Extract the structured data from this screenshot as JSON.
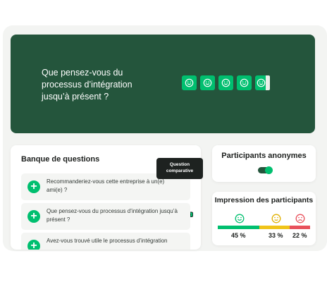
{
  "hero": {
    "question": "Que pensez-vous du processus d’intégration jusqu’à présent ?",
    "rating_icons": [
      "smiley-icon",
      "smiley-icon",
      "smiley-icon",
      "smiley-icon",
      "smiley-icon"
    ]
  },
  "question_bank": {
    "title": "Banque de questions",
    "items": [
      {
        "text": "Recommanderiez-vous cette entreprise à un(e) ami(e) ?",
        "icon": "plus-icon"
      },
      {
        "text": "Que pensez-vous du processus d’intégration jusqu’à présent ?",
        "icon": "plus-icon"
      },
      {
        "text": "Avez-vous trouvé utile le processus d’intégration",
        "icon": "plus-icon"
      }
    ]
  },
  "tooltip": {
    "text": "Question comparative"
  },
  "anonymous": {
    "title": "Participants anonymes",
    "toggle_on": true
  },
  "impression": {
    "title": "Impression des participants",
    "segments": [
      {
        "icon": "happy-face-icon",
        "percent": 45,
        "label": "45 %",
        "color": "#00bf6f"
      },
      {
        "icon": "neutral-face-icon",
        "percent": 33,
        "label": "33 %",
        "color": "#f0c419"
      },
      {
        "icon": "sad-face-icon",
        "percent": 22,
        "label": "22 %",
        "color": "#e8505b"
      }
    ]
  },
  "colors": {
    "brand_dark": "#24553c",
    "brand_green": "#00bf6f"
  }
}
